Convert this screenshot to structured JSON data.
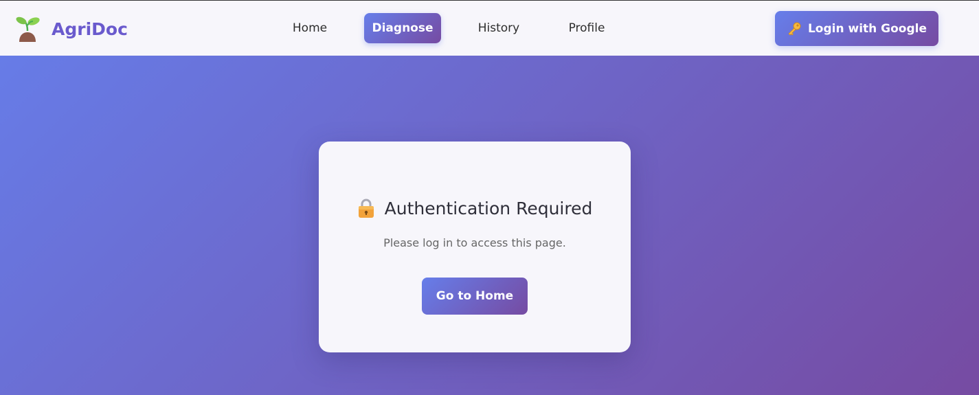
{
  "header": {
    "brand_name": "AgriDoc",
    "brand_icon": "seedling-icon",
    "nav": [
      {
        "label": "Home",
        "active": false
      },
      {
        "label": "Diagnose",
        "active": true
      },
      {
        "label": "History",
        "active": false
      },
      {
        "label": "Profile",
        "active": false
      }
    ],
    "login_label": "Login with Google",
    "login_icon": "key-icon"
  },
  "auth_card": {
    "icon": "lock-icon",
    "title": "Authentication Required",
    "message": "Please log in to access this page.",
    "button_label": "Go to Home"
  },
  "colors": {
    "gradient_start": "#667eea",
    "gradient_end": "#764ba2",
    "brand": "#6a5acd",
    "nav_bg": "#f7f6fb"
  }
}
